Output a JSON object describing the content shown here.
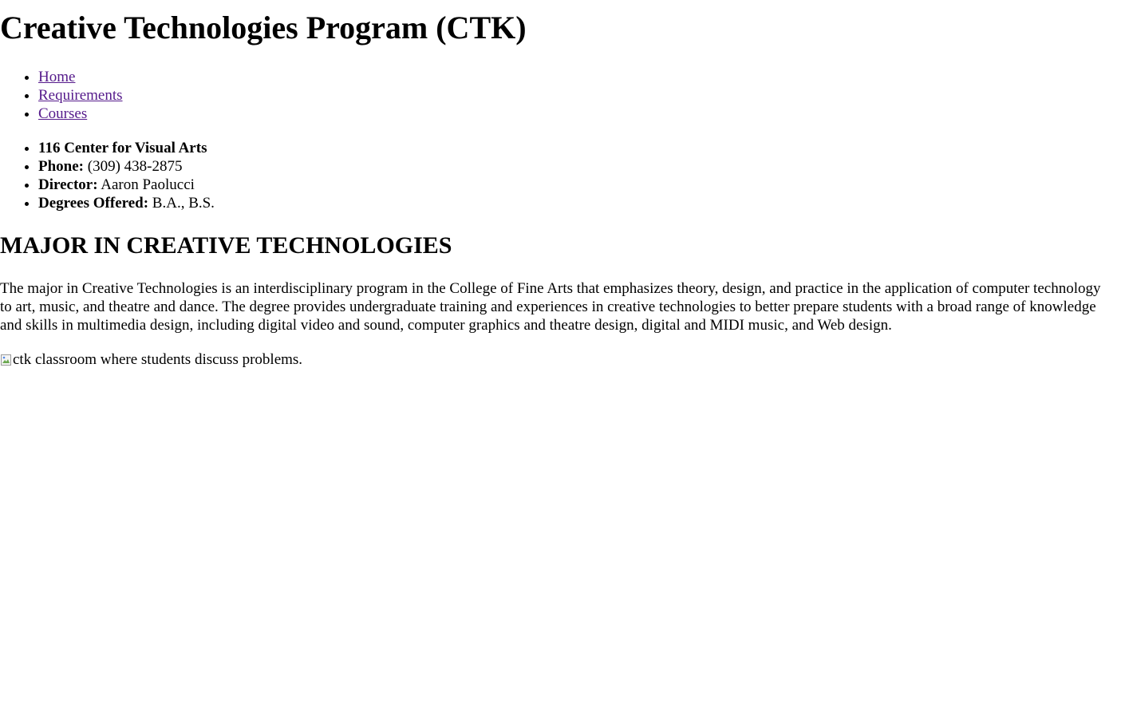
{
  "page": {
    "title": "Creative Technologies Program (CTK)"
  },
  "nav": {
    "items": [
      {
        "label": "Home"
      },
      {
        "label": "Requirements"
      },
      {
        "label": "Courses"
      }
    ]
  },
  "info": {
    "location": "116 Center for Visual Arts",
    "phone_label": "Phone:",
    "phone_value": " (309) 438-2875",
    "director_label": "Director:",
    "director_value": " Aaron Paolucci",
    "degrees_label": "Degrees Offered:",
    "degrees_value": " B.A., B.S."
  },
  "major": {
    "heading": "MAJOR IN CREATIVE TECHNOLOGIES",
    "paragraph": "The major in Creative Technologies is an interdisciplinary program in the College of Fine Arts that emphasizes theory, design, and practice in the application of computer technology to art, music, and theatre and dance. The degree provides undergraduate training and experiences in creative technologies to better prepare students with a broad range of knowledge and skills in multimedia design, including digital video and sound, computer graphics and theatre design, digital and MIDI music, and Web design."
  },
  "image": {
    "alt": "ctk classroom where students discuss problems.",
    "icon": "broken-image-icon"
  },
  "colors": {
    "visited_link": "#551a8b",
    "text": "#000000",
    "background": "#ffffff"
  }
}
